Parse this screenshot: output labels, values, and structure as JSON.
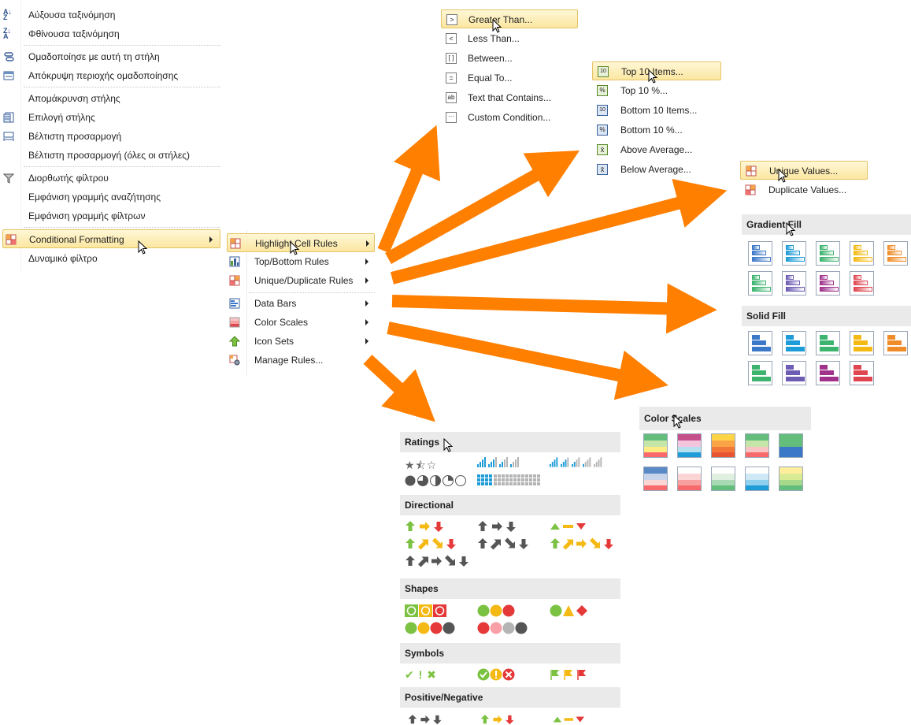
{
  "context_menu": {
    "items": [
      {
        "label": "Αύξουσα ταξινόμηση",
        "icon": "sort-ascending-icon"
      },
      {
        "label": "Φθίνουσα ταξινόμηση",
        "icon": "sort-descending-icon"
      },
      {
        "label": "Ομαδοποίησε με αυτή τη στήλη",
        "icon": "group-by-column-icon"
      },
      {
        "label": "Απόκρυψη περιοχής ομαδοποίησης",
        "icon": "group-panel-icon"
      },
      {
        "label": "Απομάκρυνση στήλης",
        "icon": ""
      },
      {
        "label": "Επιλογή στήλης",
        "icon": "column-chooser-icon"
      },
      {
        "label": "Βέλτιστη προσαρμογή",
        "icon": "best-fit-icon"
      },
      {
        "label": "Βέλτιστη προσαρμογή (όλες οι στήλες)",
        "icon": ""
      },
      {
        "label": "Διορθωτής φίλτρου",
        "icon": "filter-editor-icon"
      },
      {
        "label": "Εμφάνιση γραμμής αναζήτησης",
        "icon": ""
      },
      {
        "label": "Εμφάνιση γραμμής φίλτρων",
        "icon": ""
      },
      {
        "label": "Conditional Formatting",
        "icon": "conditional-formatting-icon"
      },
      {
        "label": "Δυναμικό φίλτρο",
        "icon": ""
      }
    ]
  },
  "cf_submenu": {
    "items": [
      {
        "label": "Highlight Cell Rules",
        "icon": "highlight-cell-rules-icon"
      },
      {
        "label": "Top/Bottom Rules",
        "icon": "top-bottom-rules-icon"
      },
      {
        "label": "Unique/Duplicate Rules",
        "icon": "unique-duplicate-rules-icon"
      },
      {
        "label": "Data Bars",
        "icon": "data-bars-icon"
      },
      {
        "label": "Color Scales",
        "icon": "color-scales-icon"
      },
      {
        "label": "Icon Sets",
        "icon": "icon-sets-icon"
      },
      {
        "label": "Manage Rules...",
        "icon": "manage-rules-icon"
      }
    ]
  },
  "highlight_submenu": {
    "items": [
      {
        "label": "Greater Than...",
        "glyph": ">"
      },
      {
        "label": "Less Than...",
        "glyph": "<"
      },
      {
        "label": "Between...",
        "glyph": "[ ]"
      },
      {
        "label": "Equal To...",
        "glyph": "="
      },
      {
        "label": "Text that Contains...",
        "glyph": "ab"
      },
      {
        "label": "Custom Condition...",
        "glyph": "···"
      }
    ]
  },
  "topbottom_submenu": {
    "items": [
      {
        "label": "Top 10 Items...",
        "glyph": "10"
      },
      {
        "label": "Top 10 %...",
        "glyph": "%"
      },
      {
        "label": "Bottom 10 Items...",
        "glyph": "10"
      },
      {
        "label": "Bottom 10 %...",
        "glyph": "%"
      },
      {
        "label": "Above Average...",
        "glyph": "x̄"
      },
      {
        "label": "Below Average...",
        "glyph": "x̄"
      }
    ]
  },
  "unique_submenu": {
    "items": [
      {
        "label": "Unique Values..."
      },
      {
        "label": "Duplicate Values..."
      }
    ]
  },
  "databars": {
    "gradient_header": "Gradient Fill",
    "solid_header": "Solid Fill",
    "colors": [
      "#3c78c8",
      "#1e9cd7",
      "#3cb46e",
      "#f5b914",
      "#f08c28",
      "#3cb46e",
      "#6c5cb4",
      "#a0328c",
      "#e04650"
    ]
  },
  "color_scales": {
    "header": "Color Scales",
    "swatches": [
      [
        "#63be7b",
        "#c6e5a8",
        "#ffeb84",
        "#f8696b"
      ],
      [
        "#c6508c",
        "#f3c6de",
        "#b4e0f0",
        "#1e9cd7"
      ],
      [
        "#ffd447",
        "#fba446",
        "#f4773a",
        "#e95433"
      ],
      [
        "#63be7b",
        "#c6e5a8",
        "#f8c4c4",
        "#f8696b"
      ],
      [
        "#63be7b",
        "#63be7b",
        "#3c78c8",
        "#3c78c8"
      ],
      [
        "#5a8ac6",
        "#c8d4ea",
        "#fbd4d4",
        "#f8696b"
      ],
      [
        "#ffffff",
        "#fbd4d4",
        "#f8a0a0",
        "#f8696b"
      ],
      [
        "#ffffff",
        "#dff0e0",
        "#a8dbb4",
        "#63be7b"
      ],
      [
        "#ffffff",
        "#cfe8f6",
        "#8fd0ee",
        "#1e9cd7"
      ],
      [
        "#ffef9c",
        "#d9ea94",
        "#a6d98c",
        "#63be7b"
      ]
    ]
  },
  "icon_sets": {
    "sections": [
      {
        "header": "Ratings"
      },
      {
        "header": "Directional"
      },
      {
        "header": "Shapes"
      },
      {
        "header": "Symbols"
      },
      {
        "header": "Positive/Negative"
      }
    ],
    "glyphs": {
      "ratings_row1": [
        "★⯪☆"
      ],
      "symbols": [
        "✔ ! ✖"
      ]
    }
  }
}
